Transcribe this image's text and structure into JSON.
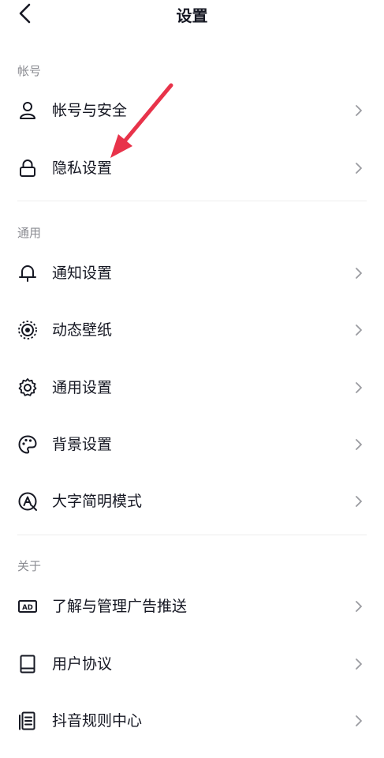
{
  "header": {
    "title": "设置"
  },
  "sections": [
    {
      "label": "帐号",
      "items": [
        {
          "label": "帐号与安全",
          "icon": "user-icon"
        },
        {
          "label": "隐私设置",
          "icon": "lock-icon"
        }
      ]
    },
    {
      "label": "通用",
      "items": [
        {
          "label": "通知设置",
          "icon": "bell-icon"
        },
        {
          "label": "动态壁纸",
          "icon": "wallpaper-icon"
        },
        {
          "label": "通用设置",
          "icon": "gear-icon"
        },
        {
          "label": "背景设置",
          "icon": "palette-icon"
        },
        {
          "label": "大字简明模式",
          "icon": "large-text-icon"
        }
      ]
    },
    {
      "label": "关于",
      "items": [
        {
          "label": "了解与管理广告推送",
          "icon": "ad-icon"
        },
        {
          "label": "用户协议",
          "icon": "book-icon"
        },
        {
          "label": "抖音规则中心",
          "icon": "document-icon"
        }
      ]
    }
  ],
  "annotation": {
    "arrow_color": "#e8334a"
  }
}
